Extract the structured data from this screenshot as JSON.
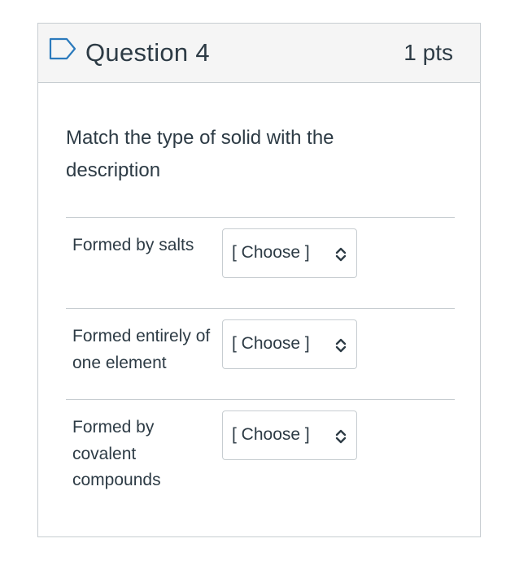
{
  "question": {
    "title": "Question 4",
    "points": "1 pts",
    "prompt": "Match the type of solid with the description"
  },
  "matches": [
    {
      "label": "Formed by salts",
      "selected": "[ Choose ]"
    },
    {
      "label": "Formed entirely of one element",
      "selected": "[ Choose ]"
    },
    {
      "label": "Formed by covalent compounds",
      "selected": "[ Choose ]"
    }
  ],
  "icons": {
    "flag": "flag-outline-icon",
    "select_arrow": "up-down-chevron-icon"
  },
  "colors": {
    "header_bg": "#f5f5f5",
    "border": "#c7cdd1",
    "text": "#2d3b45",
    "flag": "#2b7abc"
  }
}
